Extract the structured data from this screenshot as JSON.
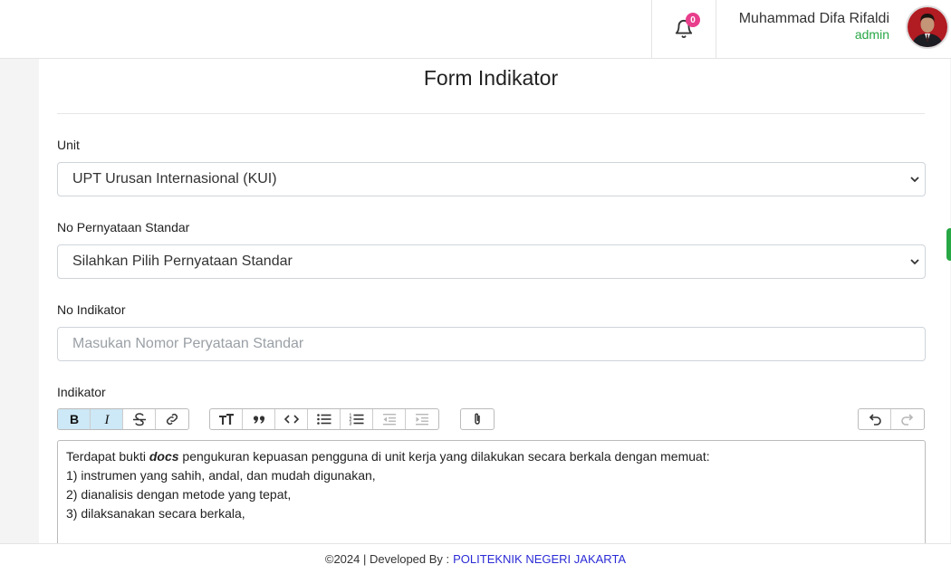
{
  "header": {
    "notification_count": "0",
    "user_name": "Muhammad Difa Rifaldi",
    "user_role": "admin"
  },
  "form": {
    "title": "Form Indikator",
    "unit": {
      "label": "Unit",
      "value": "UPT Urusan Internasional (KUI)"
    },
    "standard": {
      "label": "No Pernyataan Standar",
      "value": "Silahkan Pilih Pernyataan Standar"
    },
    "indicator_no": {
      "label": "No Indikator",
      "placeholder": "Masukan Nomor Peryataan Standar"
    },
    "indicator": {
      "label": "Indikator",
      "content": {
        "line1_before": "Terdapat bukti ",
        "line1_emphasis": "docs",
        "line1_after": " pengukuran kepuasan pengguna di unit kerja yang dilakukan secara berkala dengan memuat:",
        "line2": "1) instrumen yang sahih, andal, dan mudah digunakan,",
        "line3": "2) dianalisis dengan metode yang tepat,",
        "line4": "3) dilaksanakan secara berkala,"
      }
    }
  },
  "toolbar": {
    "buttons": [
      "bold-icon",
      "italic-icon",
      "strikethrough-icon",
      "link-icon",
      "heading-icon",
      "quote-icon",
      "code-icon",
      "bullet-list-icon",
      "numbered-list-icon",
      "decrease-indent-icon",
      "increase-indent-icon",
      "attach-icon",
      "undo-icon",
      "redo-icon"
    ]
  },
  "footer": {
    "text": "©2024 | Developed By :",
    "link": "POLITEKNIK NEGERI JAKARTA"
  },
  "colors": {
    "accent_green": "#28a745",
    "badge_pink": "#e83e8c",
    "footer_link": "#2b2bd6",
    "active_tool": "#cde8f6"
  }
}
